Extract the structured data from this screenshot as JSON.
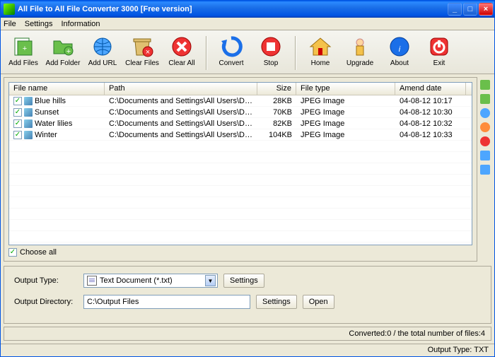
{
  "window": {
    "title": "All File to All File Converter 3000 [Free version]"
  },
  "menu": {
    "file": "File",
    "settings": "Settings",
    "info": "Information"
  },
  "toolbar": {
    "add_files": "Add Files",
    "add_folder": "Add Folder",
    "add_url": "Add URL",
    "clear_files": "Clear Files",
    "clear_all": "Clear All",
    "convert": "Convert",
    "stop": "Stop",
    "home": "Home",
    "upgrade": "Upgrade",
    "about": "About",
    "exit": "Exit"
  },
  "columns": {
    "name": "File name",
    "path": "Path",
    "size": "Size",
    "type": "File type",
    "date": "Amend date"
  },
  "files": [
    {
      "name": "Blue hills",
      "path": "C:\\Documents and Settings\\All Users\\Documents...",
      "size": "28KB",
      "type": "JPEG Image",
      "date": "04-08-12 10:17"
    },
    {
      "name": "Sunset",
      "path": "C:\\Documents and Settings\\All Users\\Documents...",
      "size": "70KB",
      "type": "JPEG Image",
      "date": "04-08-12 10:30"
    },
    {
      "name": "Water lilies",
      "path": "C:\\Documents and Settings\\All Users\\Documents...",
      "size": "82KB",
      "type": "JPEG Image",
      "date": "04-08-12 10:32"
    },
    {
      "name": "Winter",
      "path": "C:\\Documents and Settings\\All Users\\Documents...",
      "size": "104KB",
      "type": "JPEG Image",
      "date": "04-08-12 10:33"
    }
  ],
  "choose_all": "Choose all",
  "output": {
    "type_label": "Output Type:",
    "type_value": "Text Document (*.txt)",
    "dir_label": "Output Directory:",
    "dir_value": "C:\\Output Files",
    "settings_btn": "Settings",
    "open_btn": "Open"
  },
  "status": "Converted:0  /  the total number of files:4",
  "footer": "Output Type: TXT"
}
